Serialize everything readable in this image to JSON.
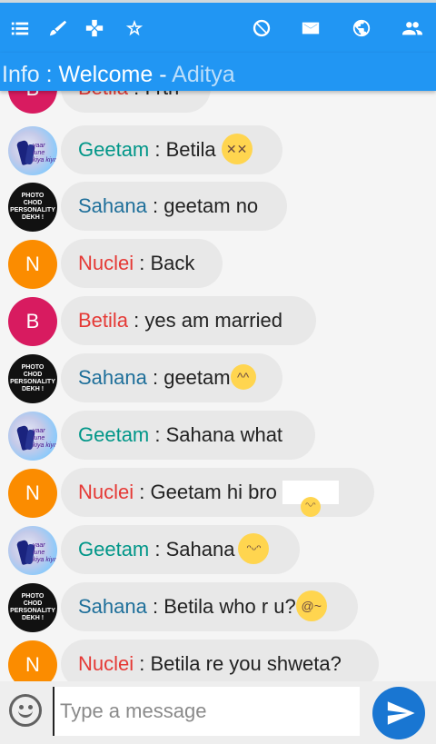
{
  "toolbar": {
    "icons": [
      "list-icon",
      "brush-icon",
      "gamepad-icon",
      "star-icon",
      "block-icon",
      "mail-icon",
      "globe-icon",
      "people-icon"
    ]
  },
  "info": {
    "label": "Info",
    "sep": " : ",
    "welcome": "Welcome",
    "dash": " - ",
    "user": "Aditya"
  },
  "messages": [
    {
      "name": "Betila",
      "sep": " : ",
      "text": "I rth",
      "avatar": "B",
      "avatar_type": "letter-b",
      "name_color": "red"
    },
    {
      "name": "Geetam",
      "sep": " : ",
      "text": "Betila",
      "avatar_type": "photo-geetam",
      "name_color": "green",
      "emoji": "dizzy-face"
    },
    {
      "name": "Sahana",
      "sep": " : ",
      "text": "geetam no",
      "avatar_type": "photo-sahana",
      "name_color": "blue"
    },
    {
      "name": "Nuclei",
      "sep": " : ",
      "text": "Back",
      "avatar": "N",
      "avatar_type": "letter-n",
      "name_color": "red"
    },
    {
      "name": "Betila",
      "sep": " : ",
      "text": "yes am married",
      "avatar": "B",
      "avatar_type": "letter-b",
      "name_color": "red"
    },
    {
      "name": "Sahana",
      "sep": " : ",
      "text": "geetam",
      "avatar_type": "photo-sahana",
      "name_color": "blue",
      "emoji": "giggling-face"
    },
    {
      "name": "Geetam",
      "sep": " : ",
      "text": "Sahana what",
      "avatar_type": "photo-geetam",
      "name_color": "green"
    },
    {
      "name": "Nuclei",
      "sep": " : ",
      "text": "Geetam hi bro",
      "avatar": "N",
      "avatar_type": "letter-n",
      "name_color": "red",
      "emoji": "smiling-face-boxed"
    },
    {
      "name": "Geetam",
      "sep": " : ",
      "text": "Sahana",
      "avatar_type": "photo-geetam",
      "name_color": "green",
      "emoji": "smiling-face"
    },
    {
      "name": "Sahana",
      "sep": " : ",
      "text": "Betila who r u?",
      "avatar_type": "photo-sahana",
      "name_color": "blue",
      "emoji": "woozy-face"
    },
    {
      "name": "Nuclei",
      "sep": " : ",
      "text": "Betila re you shweta?",
      "avatar": "N",
      "avatar_type": "letter-n",
      "name_color": "red"
    }
  ],
  "avatar_photo_sahana": [
    "PHOTO",
    "CHOD",
    "PERSONALITY",
    "DEKH !"
  ],
  "avatar_photo_geetam": "yaar lune kiya kiya",
  "composer": {
    "placeholder": "Type a message",
    "emoji_icon": "smiley-icon",
    "send_icon": "send-icon"
  },
  "colors": {
    "toolbar": "#2196f3",
    "send": "#1976d2",
    "name_green": "#009688",
    "name_blue": "#1e6f9a",
    "name_red": "#e53935"
  }
}
